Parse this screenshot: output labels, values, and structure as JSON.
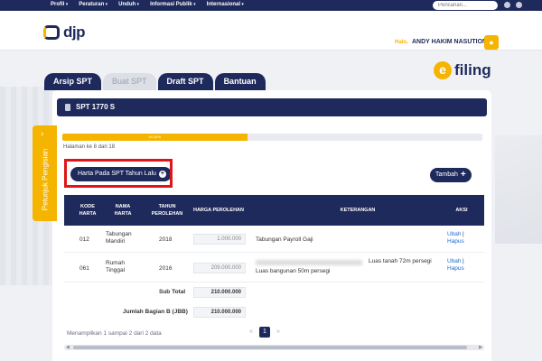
{
  "nav": {
    "items": [
      "Profil",
      "Peraturan",
      "Unduh",
      "Informasi Publik",
      "Internasional"
    ],
    "search_placeholder": "Pencarian..."
  },
  "header": {
    "logo_text": "djp",
    "greeting": "Halo,",
    "user_name": "ANDY HAKIM NASUTION",
    "avatar_icon": "user-icon"
  },
  "brand": {
    "efiling_e": "e",
    "efiling_text": "filing"
  },
  "tabs": [
    {
      "label": "Arsip SPT",
      "active": false
    },
    {
      "label": "Buat SPT",
      "active": true
    },
    {
      "label": "Draft SPT",
      "active": false
    },
    {
      "label": "Bantuan",
      "active": false
    }
  ],
  "form": {
    "title": "SPT 1770 S",
    "progress_percent": 44,
    "progress_label": "44.44%",
    "page_info": "Halaman ke 8 dari 18",
    "harta_button": "Harta Pada SPT Tahun Lalu",
    "tambah_button": "Tambah"
  },
  "sidebar": {
    "label": "Petunjuk Pengisian"
  },
  "table": {
    "headers": {
      "kode_l1": "KODE",
      "kode_l2": "HARTA",
      "nama_l1": "NAMA",
      "nama_l2": "HARTA",
      "tahun_l1": "TAHUN",
      "tahun_l2": "PEROLEHAN",
      "harga": "HARGA PEROLEHAN",
      "keterangan": "KETERANGAN",
      "aksi": "AKSI"
    },
    "rows": [
      {
        "kode": "012",
        "nama_l1": "Tabungan",
        "nama_l2": "Mandiri",
        "tahun": "2018",
        "harga": "1.000.000",
        "keterangan_l1": "Tabungan Payroll Gaji",
        "keterangan_l2": "",
        "ubah": "Ubah",
        "hapus": "Hapus"
      },
      {
        "kode": "061",
        "nama_l1": "Rumah",
        "nama_l2": "Tinggal",
        "tahun": "2016",
        "harga": "209.000.000",
        "keterangan_l1": "Luas tanah 72m persegi",
        "keterangan_l2": "Luas bangunan 50m persegi",
        "ubah": "Ubah",
        "hapus": "Hapus"
      }
    ],
    "subtotal_label": "Sub Total",
    "subtotal_value": "210.000.000",
    "jumlah_label": "Jumlah Bagian B (JBB)",
    "jumlah_value": "210.000.000"
  },
  "footer": {
    "info": "Menampilkan 1 sampai 2 dari 2 data",
    "prev": "«",
    "current_page": "1",
    "next": "»"
  }
}
